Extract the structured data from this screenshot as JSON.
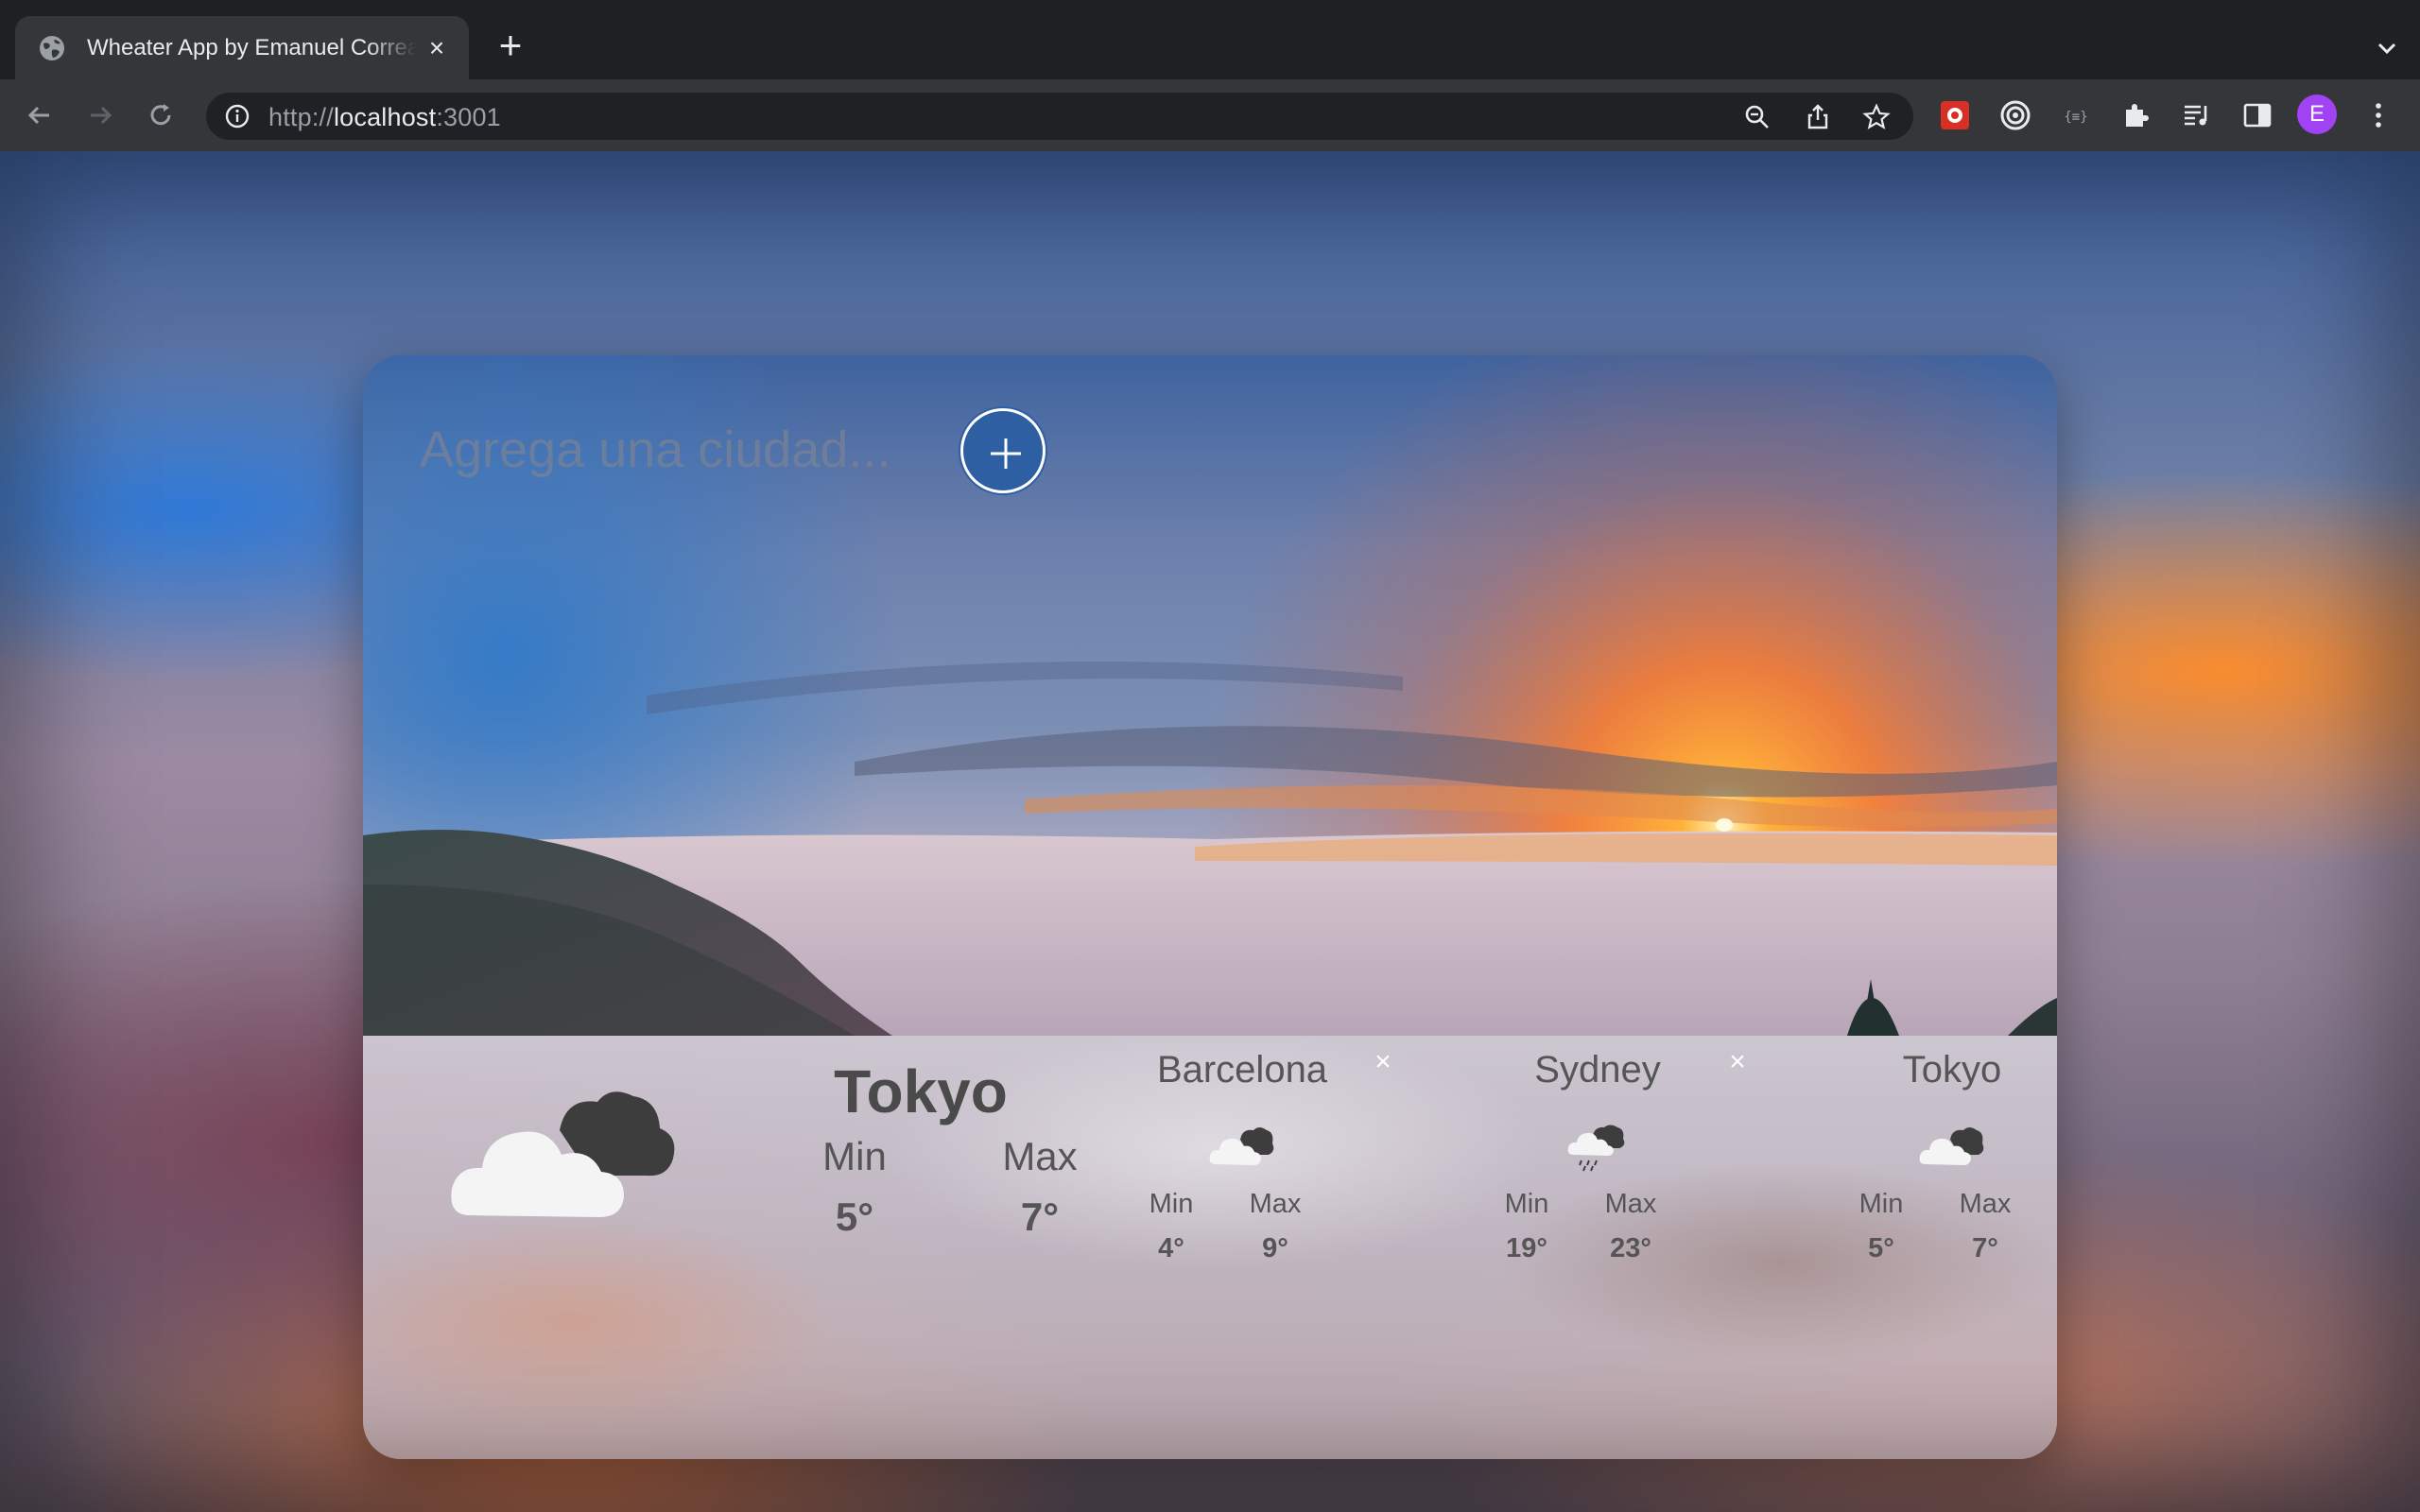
{
  "browser": {
    "tab_title": "Wheater App by Emanuel Correa",
    "url_scheme": "http://",
    "url_host": "localhost",
    "url_port": ":3001",
    "profile_initial": "E"
  },
  "app": {
    "search_placeholder": "Agrega una ciudad...",
    "main": {
      "city": "Tokyo",
      "min_label": "Min",
      "max_label": "Max",
      "min": "5°",
      "max": "7°",
      "icon": "cloudy-night-icon"
    },
    "cities": [
      {
        "name": "Barcelona",
        "min_label": "Min",
        "max_label": "Max",
        "min": "4°",
        "max": "9°",
        "icon": "cloudy-night-icon"
      },
      {
        "name": "Sydney",
        "min_label": "Min",
        "max_label": "Max",
        "min": "19°",
        "max": "23°",
        "icon": "rain-icon"
      },
      {
        "name": "Tokyo",
        "min_label": "Min",
        "max_label": "Max",
        "min": "5°",
        "max": "7°",
        "icon": "cloudy-night-icon"
      }
    ]
  }
}
